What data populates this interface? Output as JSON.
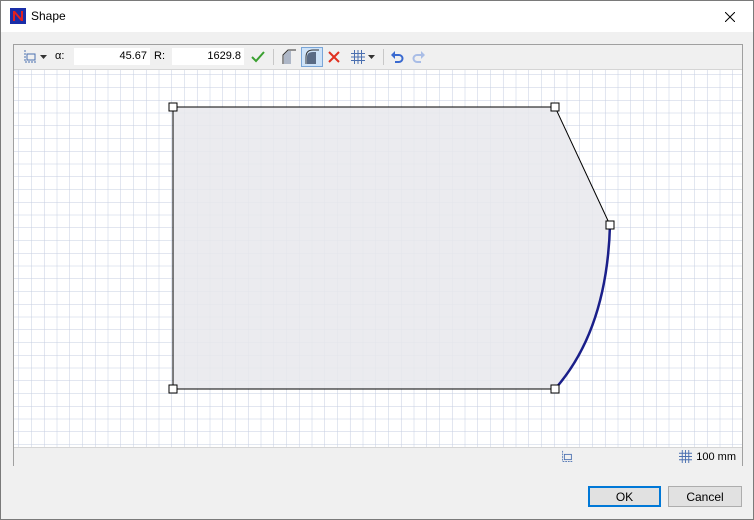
{
  "window": {
    "title": "Shape",
    "app_icon": "n-logo-icon",
    "close_icon": "close-icon"
  },
  "toolbar": {
    "shape_menu_icon": "shape-select-icon",
    "alpha_label": "α:",
    "alpha_value": "45.67",
    "radius_label": "R:",
    "radius_value": "1629.8",
    "apply_icon": "checkmark-icon",
    "tools": [
      "chamfer-icon",
      "round-corner-icon",
      "delete-icon",
      "grid-icon",
      "undo-icon",
      "redo-icon"
    ]
  },
  "statusbar": {
    "grid_size": "100 mm",
    "grid_icon": "grid-icon",
    "shape_icon": "shape-select-icon"
  },
  "buttons": {
    "ok": "OK",
    "cancel": "Cancel"
  },
  "colors": {
    "shape_fill": "#e8e8ec",
    "shape_stroke": "#000000",
    "arc_stroke": "#1a1f8a",
    "grid_line": "#c5cee0",
    "accent": "#0078d7"
  }
}
